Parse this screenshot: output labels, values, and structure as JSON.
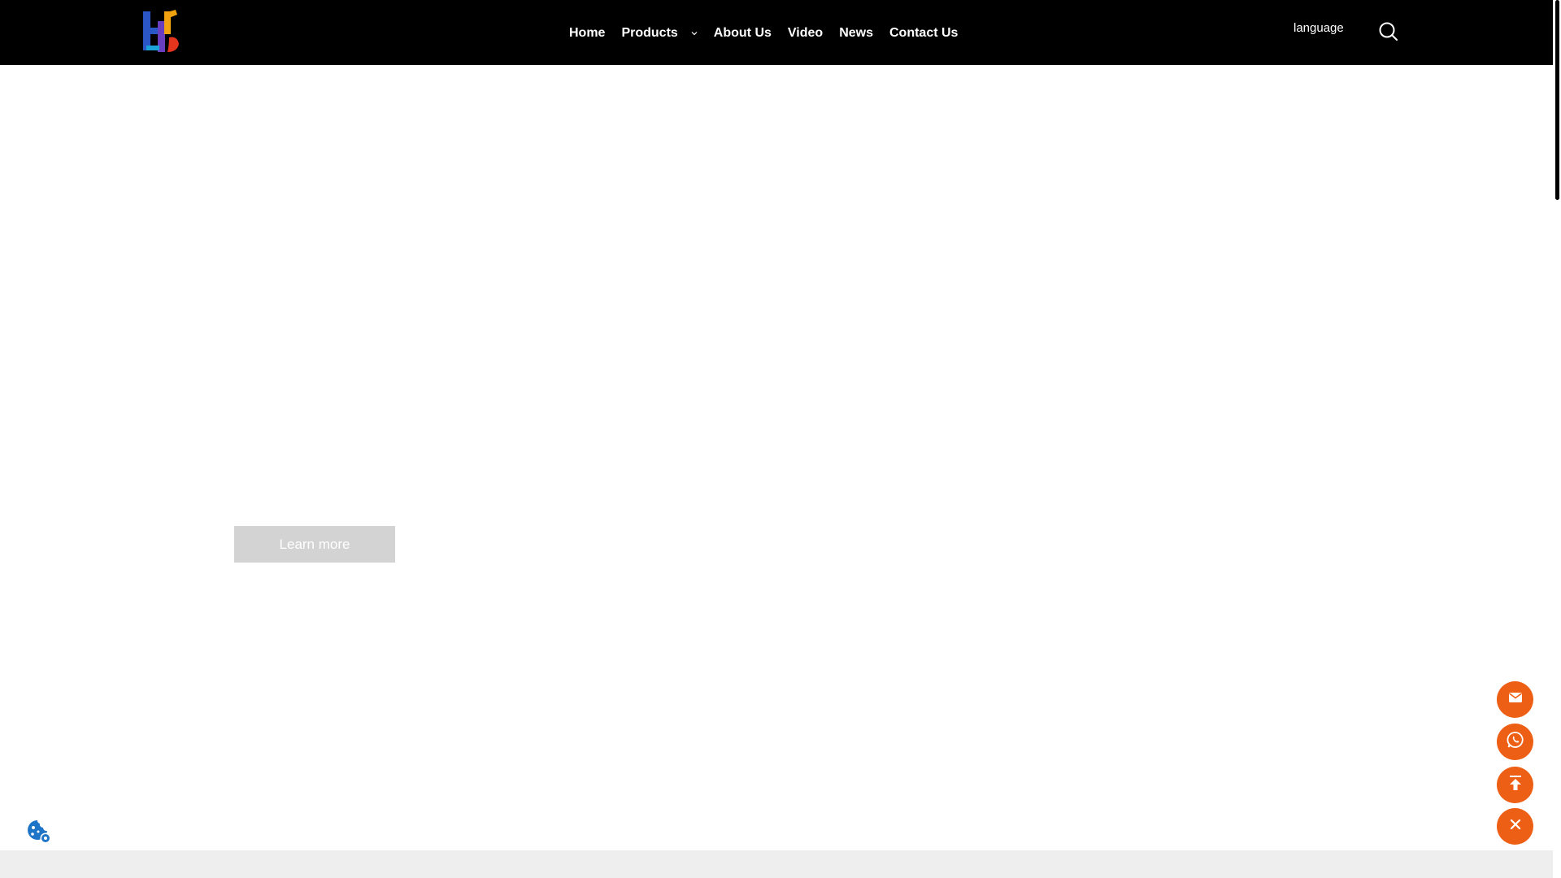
{
  "header": {
    "logo_alt": "Company logo",
    "nav": {
      "home": "Home",
      "products": "Products",
      "about": "About Us",
      "video": "Video",
      "news": "News",
      "contact": "Contact Us"
    },
    "language_label": "language",
    "search_icon": "search-icon"
  },
  "hero": {
    "learn_more_label": "Learn more"
  },
  "floating_actions": {
    "email_icon": "envelope-icon",
    "whatsapp_icon": "whatsapp-icon",
    "top_icon": "arrow-up-icon",
    "close_icon": "close-icon"
  },
  "cookie": {
    "icon": "cookie-settings-icon"
  },
  "colors": {
    "header_bg": "#000000",
    "accent": "#ee5f16",
    "button_bg": "#d3d3d3",
    "cookie_icon": "#1e74c6"
  }
}
